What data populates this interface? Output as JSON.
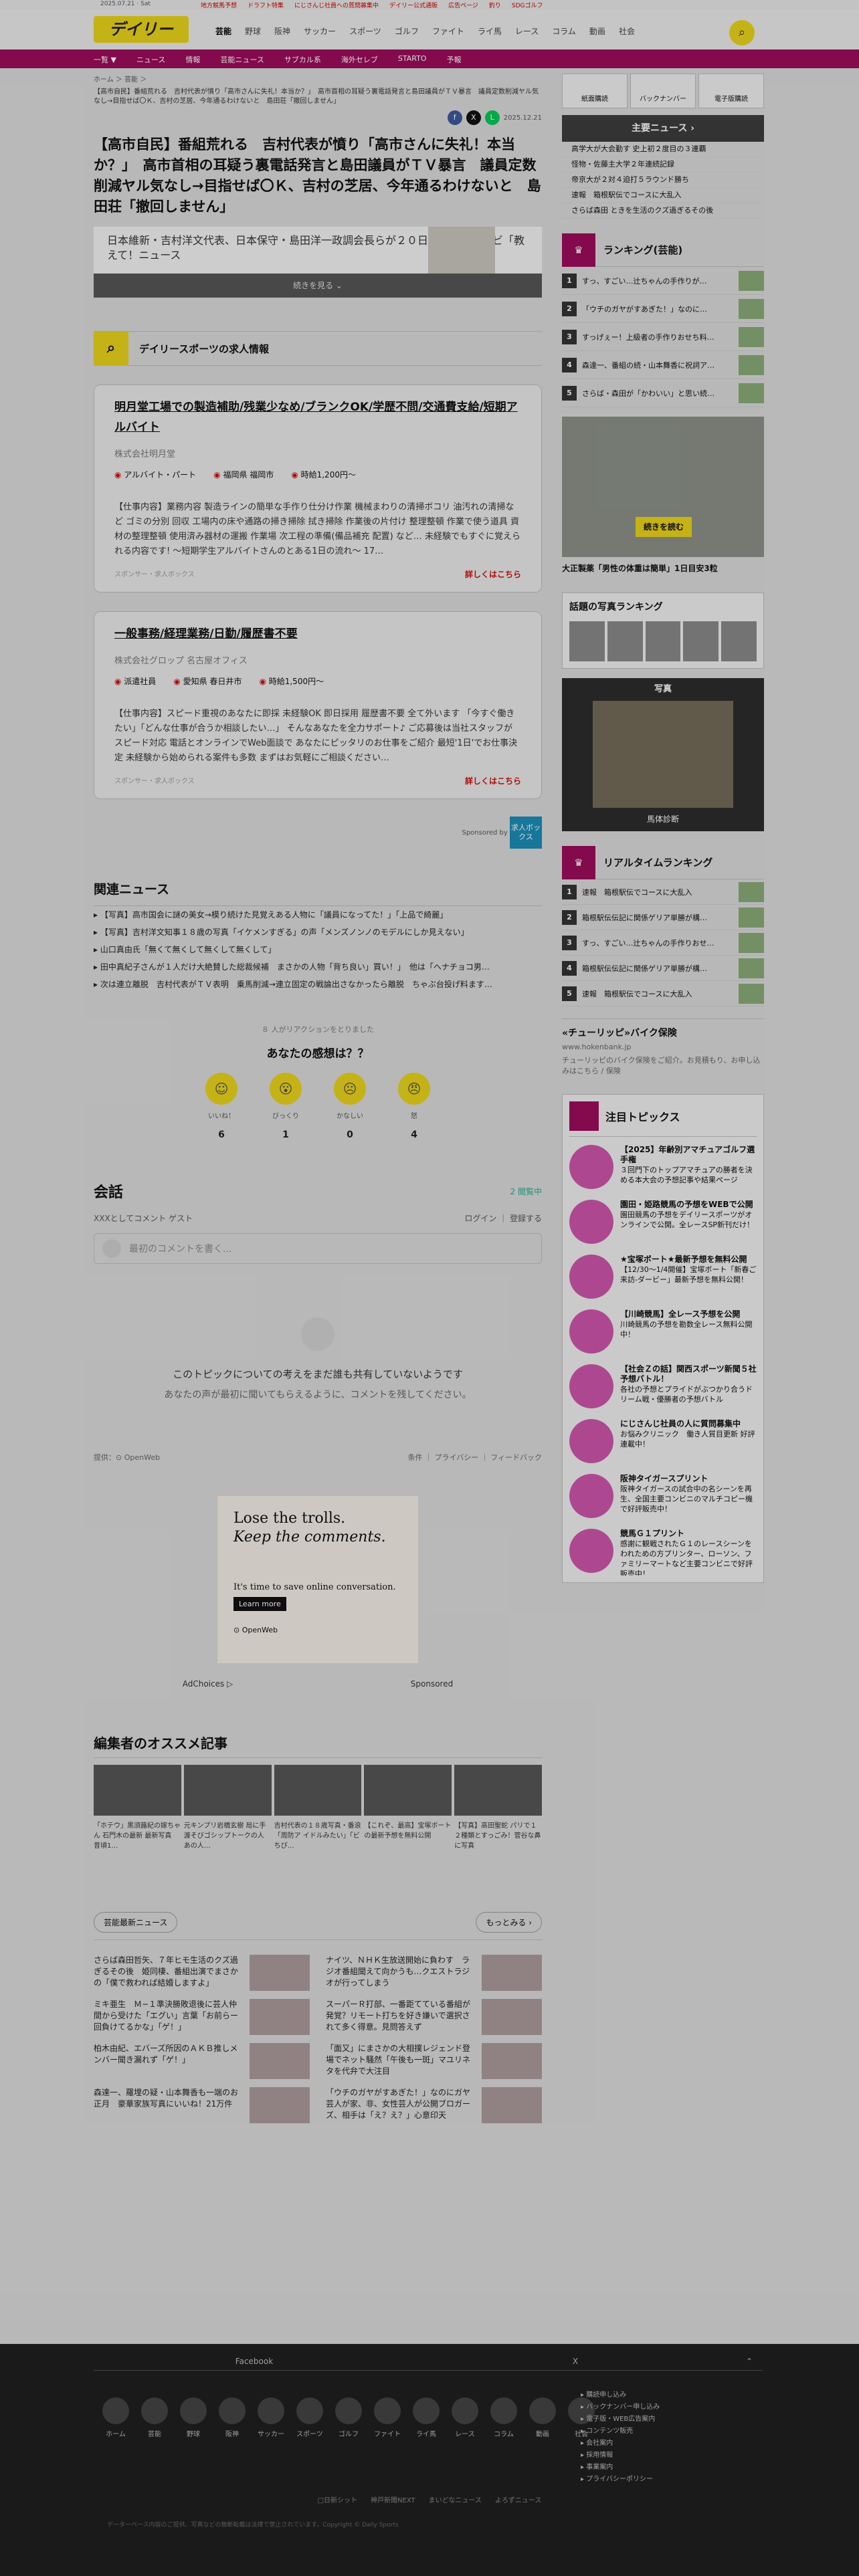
{
  "topbar": {
    "date": "2025.07.21 · Sat",
    "links": [
      "地方競馬予想",
      "ドラフト特集",
      "にじさんじ社員への質問募集中",
      "デイリー公式通販",
      "広告ページ",
      "釣り",
      "SDGゴルフ"
    ]
  },
  "header": {
    "logo": "デイリー",
    "nav": [
      "芸能",
      "野球",
      "阪神",
      "サッカー",
      "スポーツ",
      "ゴルフ",
      "ファイト",
      "ライ馬",
      "レース",
      "コラム",
      "動画",
      "社会"
    ]
  },
  "subnav": [
    "一覧 ▼",
    "ニュース",
    "情報",
    "芸能ニュース",
    "サブカル系",
    "海外セレブ",
    "STARTO",
    "予報"
  ],
  "article": {
    "breadcrumb": "ホーム ＞ 芸能 ＞",
    "lead": "【高市自民】番組荒れる　吉村代表が憤り「高市さんに失礼！本当か？」　高市首相の耳疑う裏電話発言と島田議員がＴＶ暴言　議員定数削減ヤル気なし→目指せば〇Ｋ、吉村の芝居、今年通るわけないと　島田荘「撤回しません」",
    "date": "2025.12.21",
    "title": "【高市自民】番組荒れる　吉村代表が憤り「高市さんに失礼！本当か？」　高市首相の耳疑う裏電話発言と島田議員がＴＶ暴言　議員定数削減ヤル気なし→目指せば〇Ｋ、吉村の芝居、今年通るわけないと　島田荘「撤回しません」",
    "summary": "日本維新・吉村洋文代表、日本保守・島田洋一政調会長らが２０日、ＡＢＣテレビ「教えて！ニュース",
    "more": "続きを見る ⌄"
  },
  "jobs": {
    "title": "デイリースポーツの求人情報",
    "items": [
      {
        "title": "明月堂工場での製造補助/残業少なめ/ブランクOK/学歴不問/交通費支給/短期アルバイト",
        "company": "株式会社明月堂",
        "type": "アルバイト・パート",
        "place": "福岡県 福岡市",
        "pay": "時給1,200円〜",
        "desc": "【仕事内容】業務内容 製造ラインの簡単な手作り仕分け作業 機械まわりの清掃ボコリ 油汚れの清掃など ゴミの分別 回収 工場内の床や通路の掃き掃除 拭き掃除 作業後の片付け 整理整頓 作業で使う道具 資材の整理整頓 使用済み器材の運搬 作業場 次工程の準備(備品補充 配置) など… 未経験でもすぐに覚えられる内容です! 〜短期学生アルバイトさんのとある1日の流れ〜 17…",
        "source": "スポンサー・求人ボックス",
        "link": "詳しくはこちら"
      },
      {
        "title": "一般事務/経理業務/日勤/履歴書不要",
        "company": "株式会社グロップ 名古屋オフィス",
        "type": "派遣社員",
        "place": "愛知県 春日井市",
        "pay": "時給1,500円〜",
        "desc": "【仕事内容】スピード重視のあなたに即採 未経験OK 即日採用 履歴書不要 全て外います 「今すぐ働きたい」「どんな仕事が合うか相談したい…」 そんなあなたを全力サポート♪ ご応募後は当社スタッフがスピード対応 電話とオンラインでWeb面談で あなたにピッタリのお仕事をご紹介 最短'1日'でお仕事決定 未経験から始められる案件も多数 まずはお気軽にご相談ください…",
        "source": "スポンサー・求人ボックス",
        "link": "詳しくはこちら"
      }
    ],
    "sponsor": "Sponsored by",
    "sponsor_logo": "求人ボックス"
  },
  "related": {
    "title": "関連ニュース",
    "items": [
      "【写真】高市国会に謎の美女→模り続けた見覚えある人物に「議員になってた！」「上品で綺麗」",
      "【写真】吉村洋文知事１８歳の写真「イケメンすぎる」の声「メンズノンノのモデルにしか見えない」",
      "山口真由氏「無くて無くして無くして無くして」",
      "田中真紀子さんが１人だけ大絶賛した総裁候補　まさかの人物「背ち良い」買い！」　他は「ヘナチョコ男…",
      "次は連立離脱　吉村代表がＴＶ表明　乗馬削減→連立固定の戦論出さなかったら離脱　ちゃぶ台投げ料ます…"
    ]
  },
  "reactions": {
    "count": "８ 人がリアクションをとりました",
    "question": "あなたの感想は？？",
    "items": [
      {
        "label": "いいね！",
        "n": "6",
        "emoji": "☺"
      },
      {
        "label": "びっくり",
        "n": "1",
        "emoji": "😮"
      },
      {
        "label": "かなしい",
        "n": "0",
        "emoji": "☹"
      },
      {
        "label": "怒",
        "n": "4",
        "emoji": "😠"
      }
    ]
  },
  "conversation": {
    "title": "会話",
    "users": "2 閲覧中",
    "guest": "XXXとしてコメント ゲスト",
    "login": "ログイン",
    "register": "登録する",
    "placeholder": "最初のコメントを書く...",
    "empty1": "このトピックについての考えをまだ誰も共有していないようです",
    "empty2": "あなたの声が最初に聞いてもらえるように、コメントを残してください。",
    "by": "提供：⊙ OpenWeb",
    "links": "条件 ｜ プライバシー ｜ フィードバック"
  },
  "ad": {
    "l1": "Lose the trolls.",
    "l2": "Keep the comments.",
    "l3": "It's time to save online conversation.",
    "btn": "Learn more",
    "brand": "⊙ OpenWeb",
    "adchoices": "AdChoices ▷",
    "sponsored": "Sponsored"
  },
  "editor": {
    "title": "編集者のオススメ記事",
    "items": [
      "「ホテウ」黒須蕗紀の嫁ちゃん 石門木の最新 最新写真　昔頃1…",
      "元キンプリ岩橋玄樹 局に手渡そびゴシップトークの人 あの人…",
      "吉村代表の１８歳写真・番浪「周防ア イドルみたい」「ビ ちぴ…",
      "【これぞ、最高】宝塚ボートの最新予想を無料公開",
      "【写真】高田聖蛇 パリで１２種類とすっごみ！菅谷な鼻に写真"
    ]
  },
  "ent": {
    "title": "芸能最新ニュース",
    "more": "もっとみる ›",
    "items": [
      "さらば森田哲矢、７年ヒモ生活のクズ過ぎるその後　姫同棲、番組出演でまさかの「僕で救われば結婚しますよ」",
      "ナイツ、ＮＨＫ生放送開始に負わす　ラジオ番組聞えて向かうも…クエストラジオが行ってしまう",
      "ミキ亜生　Ｍ−１準決勝敗退後に芸人仲間から受けた「エグい」言葉「お前らー回負けてるかな」「ゲ！」",
      "スーパーＲ打部、一番距てている番組が発覚？リモート打ちを好き嫌いで選択されて多く得意。見問答えず",
      "柏木由紀、エバーズ所因のＡＫＢ推しメンバー聞き漏れず「ゲ！」",
      "「面又」にまさかの大相撲レジェンド登場でネット騒然「午後も一斑」マユリネタを代弁で大注目",
      "森達一、羅埋の疑・山本舞香も一端のお正月　豪華家族写真にいいね！21万件",
      "「ウチのガヤがすあぎた！」なのにガヤ芸人が家、非、女性芸人が公開ブロガーズ、相手は「え？え？」心意印天"
    ]
  },
  "side": {
    "buttons": [
      "紙面購読",
      "バックナンバー",
      "電子版購読"
    ],
    "news_title": "主要ニュース ›",
    "news": [
      "高学大が大会勤す 史上初２度目の３連覇",
      "怪物・佐藤主大学２年連続記録",
      "帝京大が２対４迫打５ラウンド勝ち",
      "速報　箱根駅伝でコースに大乱入",
      "さらば森田 ときを生活のクズ過ぎるその後"
    ],
    "rank_title": "ランキング(芸能)",
    "rank": [
      "すっ、すごい…辻ちゃんの手作りが…",
      "「ウチのガヤがすあぎた！」なのに…",
      "すっげぇー！上級者の手作りおせち料…",
      "森達一、番組の続・山本舞香に祝詞ア…",
      "さらば・森田が「かわいい」と思い続…"
    ],
    "ad_badge": "続きを読む",
    "ad_caption": "大正製薬「男性の体重は簡単」1日目安3粒",
    "photo_rank_title": "話題の写真ランキング",
    "photo_title": "写真",
    "photo_caption": "馬体診断",
    "rt_title": "リアルタイムランキング",
    "rt": [
      "速報　箱根駅伝でコースに大乱入",
      "箱根駅伝伝記に関係ゲリア単勝が構…",
      "すっ、すごい…辻ちゃんの手作りおせ…",
      "箱根駅伝伝記に関係ゲリア単勝が構…",
      "速報　箱根駅伝でコースに大乱入"
    ],
    "chu_title": "«チューリッピ»バイク保険",
    "chu_sub": "www.hokenbank.jp",
    "chu_desc": "チューリッピのバイク保険をご紹介。お見積もり、お申し込みはこちら / 保険",
    "topics_title": "注目トピックス",
    "topics": [
      {
        "t": "【2025】年齢別アマチュアゴルフ選手権",
        "d": "３回門下のトップアマチュアの勝者を決める本大会の予想記事や結果ページ"
      },
      {
        "t": "園田・姫路競馬の予想をWEBで公開",
        "d": "園田競馬の予想をデイリースポーツがオンラインで公開。全レースSP新刊だけ！"
      },
      {
        "t": "★宝塚ボート★最新予想を無料公開",
        "d": "【12/30〜1/4開催】宝塚ボート「新春ご来訪-ダービー」最新予想を無料公開！"
      },
      {
        "t": "【川崎競馬】全レース予想を公開",
        "d": "川崎競馬の予想を勘数全レース無料公開中！"
      },
      {
        "t": "【社会Ｚの話】関西スポーツ新聞５社予想バトル！",
        "d": "各社の予想とプライドがぶつかり合うドリーム戦・優勝者の予想バトル"
      },
      {
        "t": "にじさんじ社員の人に質問募集中",
        "d": "お悩みクリニック　働き人質目更新 好評連載中！"
      },
      {
        "t": "阪神タイガースプリント",
        "d": "阪神タイガースの試合中の名シーンを再生、全国主要コンビニのマルチコピー機で好評販売中！"
      },
      {
        "t": "競馬Ｇ１プリント",
        "d": "感謝に観戦されたＧ１のレースシーンをわれための方プリンター、ローソン、ファミリーマートなど主要コンビニで好評販売中！"
      }
    ]
  },
  "footer": {
    "social": [
      "Facebook",
      "X",
      "⌃"
    ],
    "cats": [
      "ホーム",
      "芸能",
      "野球",
      "阪神",
      "サッカー",
      "スポーツ",
      "ゴルフ",
      "ファイト",
      "ライ馬",
      "レース",
      "コラム",
      "動画",
      "社会"
    ],
    "links": [
      "▸ 購読申し込み",
      "▸ バックナンバー申し込み",
      "▸ 電子版・WEB広告案内",
      "▸ コンテンツ販売",
      "▸ 会社案内",
      "▸ 採用情報",
      "▸ 事業案内",
      "▸ プライバシーポリシー"
    ],
    "bottom": "□日新シット　　神戸新聞NEXT　　まいどなニュース　　よろずニュース",
    "copy": "データーベース内容のご提供、写真などの無断転載は法律で禁止されています。Copyright © Daily Sports"
  }
}
